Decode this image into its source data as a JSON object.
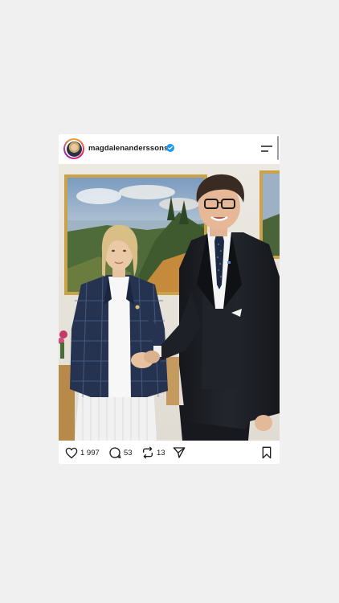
{
  "post": {
    "username": "magdalenanderssons",
    "verified": true,
    "likes": "1 997",
    "comments": "53",
    "reposts": "13"
  },
  "icons": {
    "avatar": "profile-avatar",
    "verified": "verified-badge-icon",
    "menu": "menu-icon",
    "like": "heart-icon",
    "comment": "comment-bubble-icon",
    "repost": "repost-icon",
    "share": "send-icon",
    "save": "bookmark-icon"
  },
  "colors": {
    "verified": "#1d9bf0",
    "text": "#1a1a1a",
    "background": "#f0f0f0"
  }
}
